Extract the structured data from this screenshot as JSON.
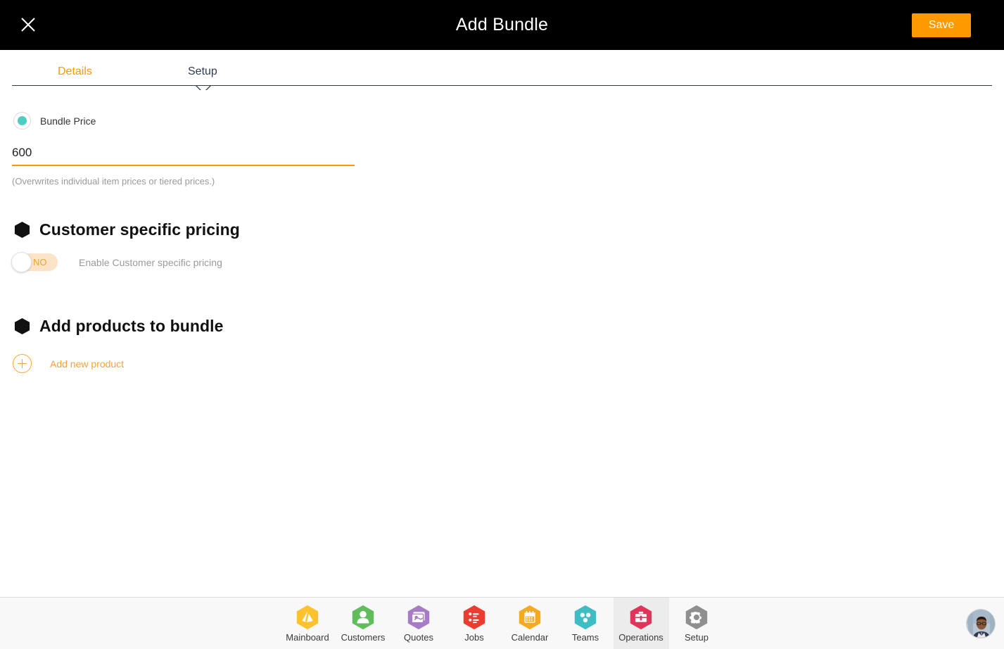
{
  "window": {
    "title": "Add Bundle",
    "close_icon": "close-icon",
    "save_label": "Save"
  },
  "tabs": [
    {
      "label": "Details",
      "active": false
    },
    {
      "label": "Setup",
      "active": true
    }
  ],
  "pricing": {
    "radio_label": "Bundle Price",
    "radio_selected": true,
    "price_value": "600",
    "price_placeholder": "",
    "help_text": "(Overwrites individual item prices or tiered prices.)"
  },
  "customer_specific_pricing": {
    "heading": "Customer specific pricing",
    "toggle_state": "NO",
    "toggle_enabled": false,
    "toggle_label": "Enable Customer specific pricing"
  },
  "add_products": {
    "heading": "Add products to bundle",
    "add_new_label": "Add new product",
    "add_icon": "plus-circle-icon"
  },
  "footer_nav": {
    "items": [
      {
        "label": "Mainboard",
        "icon": "mainboard-icon",
        "color": "#fdc22e",
        "active": false
      },
      {
        "label": "Customers",
        "icon": "customers-icon",
        "color": "#61bc5b",
        "active": false
      },
      {
        "label": "Quotes",
        "icon": "quotes-icon",
        "color": "#a67cc4",
        "active": false
      },
      {
        "label": "Jobs",
        "icon": "jobs-icon",
        "color": "#ec3b31",
        "active": false
      },
      {
        "label": "Calendar",
        "icon": "calendar-icon",
        "color": "#f5ab21",
        "active": false
      },
      {
        "label": "Teams",
        "icon": "teams-icon",
        "color": "#40bcc4",
        "active": false
      },
      {
        "label": "Operations",
        "icon": "operations-icon",
        "color": "#e0355a",
        "active": true
      },
      {
        "label": "Setup",
        "icon": "setup-gear-icon",
        "color": "#8f8f8f",
        "active": false
      }
    ],
    "avatar": "user-avatar"
  },
  "colors": {
    "accent_orange": "#ff9900",
    "topbar_black": "#000000",
    "tab_navy": "#2f3b4c",
    "radio_teal": "#4ecdc4",
    "toggle_track": "#fbe3c8",
    "footer_bg": "#f8f8f8"
  }
}
